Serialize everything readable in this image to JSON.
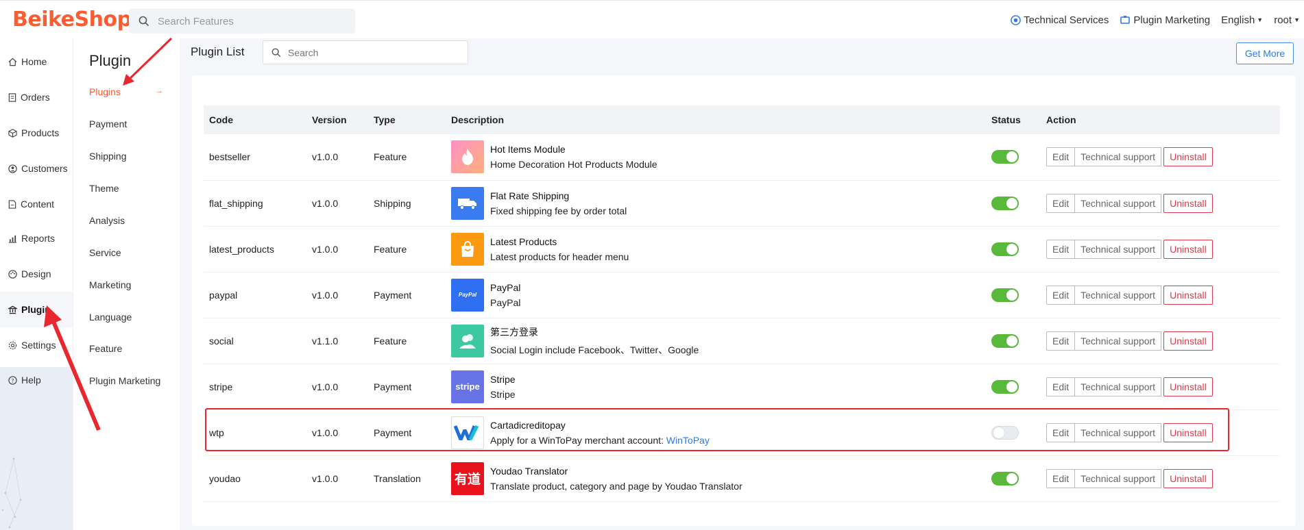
{
  "app": {
    "logo": "BeikeShop"
  },
  "header": {
    "search_placeholder": "Search Features",
    "tech_services": "Technical Services",
    "plugin_marketing": "Plugin Marketing",
    "language": "English",
    "user": "root"
  },
  "sidebar": {
    "items": [
      {
        "label": "Home",
        "icon": "home-icon"
      },
      {
        "label": "Orders",
        "icon": "orders-icon"
      },
      {
        "label": "Products",
        "icon": "products-icon"
      },
      {
        "label": "Customers",
        "icon": "customers-icon"
      },
      {
        "label": "Content",
        "icon": "content-icon"
      },
      {
        "label": "Reports",
        "icon": "reports-icon"
      },
      {
        "label": "Design",
        "icon": "design-icon"
      },
      {
        "label": "Plugin",
        "icon": "plugin-icon"
      },
      {
        "label": "Settings",
        "icon": "settings-icon"
      },
      {
        "label": "Help",
        "icon": "help-icon"
      }
    ]
  },
  "sub_sidebar": {
    "title": "Plugin",
    "items": [
      {
        "label": "Plugins"
      },
      {
        "label": "Payment"
      },
      {
        "label": "Shipping"
      },
      {
        "label": "Theme"
      },
      {
        "label": "Analysis"
      },
      {
        "label": "Service"
      },
      {
        "label": "Marketing"
      },
      {
        "label": "Language"
      },
      {
        "label": "Feature"
      },
      {
        "label": "Plugin Marketing"
      }
    ]
  },
  "main": {
    "title": "Plugin List",
    "search_placeholder": "Search",
    "get_more": "Get More"
  },
  "table": {
    "headers": {
      "code": "Code",
      "version": "Version",
      "type": "Type",
      "description": "Description",
      "status": "Status",
      "action": "Action"
    },
    "actions": {
      "edit": "Edit",
      "support": "Technical support",
      "uninstall": "Uninstall"
    },
    "rows": [
      {
        "code": "bestseller",
        "version": "v1.0.0",
        "type": "Feature",
        "name": "Hot Items Module",
        "desc": "Home Decoration Hot Products Module",
        "enabled": true
      },
      {
        "code": "flat_shipping",
        "version": "v1.0.0",
        "type": "Shipping",
        "name": "Flat Rate Shipping",
        "desc": "Fixed shipping fee by order total",
        "enabled": true
      },
      {
        "code": "latest_products",
        "version": "v1.0.0",
        "type": "Feature",
        "name": "Latest Products",
        "desc": "Latest products for header menu",
        "enabled": true
      },
      {
        "code": "paypal",
        "version": "v1.0.0",
        "type": "Payment",
        "name": "PayPal",
        "desc": "PayPal",
        "enabled": true
      },
      {
        "code": "social",
        "version": "v1.1.0",
        "type": "Feature",
        "name": "第三方登录",
        "desc": "Social Login include Facebook、Twitter、Google",
        "enabled": true
      },
      {
        "code": "stripe",
        "version": "v1.0.0",
        "type": "Payment",
        "name": "Stripe",
        "desc": "Stripe",
        "enabled": true
      },
      {
        "code": "wtp",
        "version": "v1.0.0",
        "type": "Payment",
        "name": "Cartadicreditopay",
        "desc": "Apply for a WinToPay merchant account: ",
        "link": "WinToPay",
        "enabled": false
      },
      {
        "code": "youdao",
        "version": "v1.0.0",
        "type": "Translation",
        "name": "Youdao Translator",
        "desc": "Translate product, category and page by Youdao Translator",
        "enabled": true
      }
    ]
  },
  "icon_text": {
    "paypal": "PayPal",
    "stripe": "stripe",
    "youdao": "有道"
  },
  "colors": {
    "brand": "#fd5c33",
    "toggle_on": "#58b93a",
    "danger": "#e0394a",
    "link": "#2d7ae5"
  }
}
